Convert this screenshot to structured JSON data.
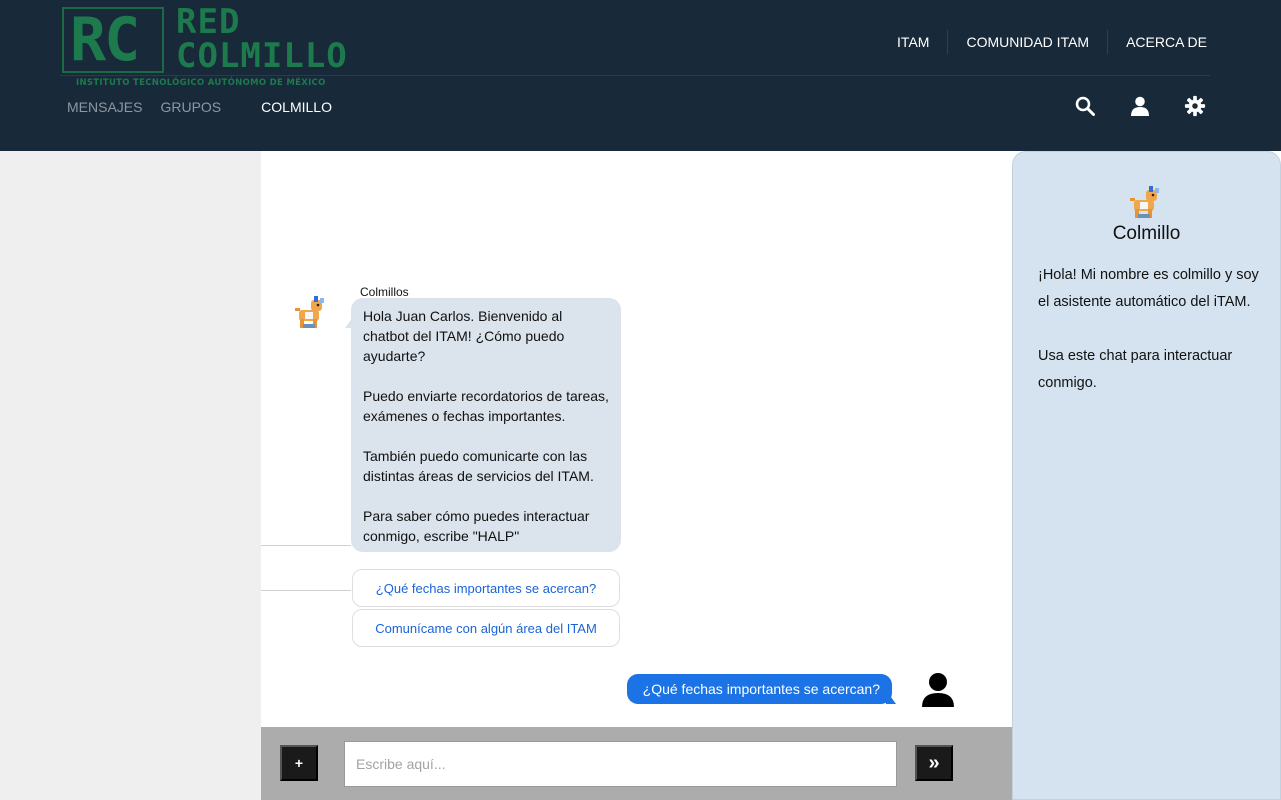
{
  "header": {
    "logo": {
      "initials": "RC",
      "line1": "RED",
      "line2": "COLMILLO",
      "subtitle": "INSTITUTO TECNOLÓGICO AUTÓNOMO DE MÉXICO"
    },
    "top_nav": [
      {
        "label": "ITAM"
      },
      {
        "label": "COMUNIDAD ITAM"
      },
      {
        "label": "ACERCA DE"
      }
    ],
    "sub_nav": [
      {
        "label": "MENSAJES"
      },
      {
        "label": "GRUPOS"
      },
      {
        "label": "COLMILLO"
      }
    ],
    "icons": [
      "search-icon",
      "user-icon",
      "gear-icon"
    ]
  },
  "chat": {
    "bot_name": "Colmillos",
    "bot_message": [
      "Hola Juan Carlos. Bienvenido al chatbot del ITAM! ¿Cómo puedo ayudarte?",
      "Puedo enviarte recordatorios de tareas, exámenes o fechas importantes.",
      "También puedo comunicarte con las distintas áreas de servicios del ITAM.",
      "Para saber cómo puedes interactuar conmigo, escribe \"HALP\""
    ],
    "quick_replies": [
      {
        "label": "¿Qué fechas importantes se acercan?"
      },
      {
        "label": "Comunícame con algún área del ITAM"
      }
    ],
    "user_message": "¿Qué fechas importantes se acercan?"
  },
  "input": {
    "plus_label": "+",
    "placeholder": "Escribe aquí...",
    "value": "",
    "send_label": "»"
  },
  "panel": {
    "title": "Colmillo",
    "paragraphs": [
      "¡Hola! Mi nombre es colmillo y soy el asistente automático del iTAM.",
      "Usa este chat para interactuar conmigo."
    ]
  },
  "colors": {
    "header_bg": "#18293a",
    "logo_green": "#1d7a4d",
    "bot_bubble": "#dbe3ec",
    "user_bubble": "#1b73e6",
    "panel_bg": "#d5e3f0",
    "link_blue": "#1a63d8"
  }
}
